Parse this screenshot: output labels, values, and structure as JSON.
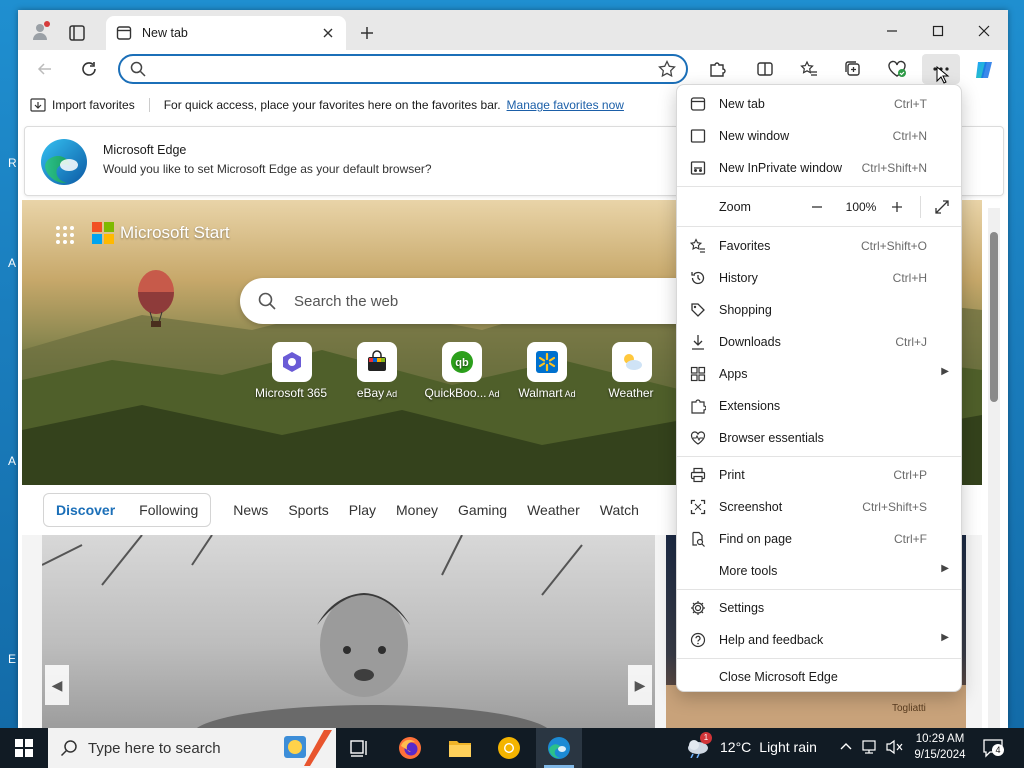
{
  "browser": {
    "tab_title": "New tab",
    "address_value": "",
    "favorites_bar": {
      "import_label": "Import favorites",
      "message": "For quick access, place your favorites here on the favorites bar.",
      "manage_link": "Manage favorites now"
    },
    "banner": {
      "title": "Microsoft Edge",
      "text": "Would you like to set Microsoft Edge as your default browser?"
    }
  },
  "new_tab_page": {
    "brand": "Microsoft Start",
    "search_placeholder": "Search the web",
    "quick_links": [
      {
        "label": "Microsoft 365",
        "ad": ""
      },
      {
        "label": "eBay",
        "ad": "Ad"
      },
      {
        "label": "QuickBoo...",
        "ad": "Ad"
      },
      {
        "label": "Walmart",
        "ad": "Ad"
      },
      {
        "label": "Weather",
        "ad": ""
      }
    ],
    "nav": {
      "discover": "Discover",
      "following": "Following",
      "items": [
        "News",
        "Sports",
        "Play",
        "Money",
        "Gaming",
        "Weather",
        "Watch"
      ]
    },
    "card2_caption": "Togliatti"
  },
  "menu": {
    "new_tab": {
      "label": "New tab",
      "shortcut": "Ctrl+T"
    },
    "new_window": {
      "label": "New window",
      "shortcut": "Ctrl+N"
    },
    "new_inprivate": {
      "label": "New InPrivate window",
      "shortcut": "Ctrl+Shift+N"
    },
    "zoom": {
      "label": "Zoom",
      "value": "100%",
      "minus": "—",
      "plus": "+"
    },
    "favorites": {
      "label": "Favorites",
      "shortcut": "Ctrl+Shift+O"
    },
    "history": {
      "label": "History",
      "shortcut": "Ctrl+H"
    },
    "shopping": {
      "label": "Shopping",
      "shortcut": ""
    },
    "downloads": {
      "label": "Downloads",
      "shortcut": "Ctrl+J"
    },
    "apps": {
      "label": "Apps",
      "shortcut": ""
    },
    "extensions": {
      "label": "Extensions",
      "shortcut": ""
    },
    "browser_essentials": {
      "label": "Browser essentials",
      "shortcut": ""
    },
    "print": {
      "label": "Print",
      "shortcut": "Ctrl+P"
    },
    "screenshot": {
      "label": "Screenshot",
      "shortcut": "Ctrl+Shift+S"
    },
    "find_on_page": {
      "label": "Find on page",
      "shortcut": "Ctrl+F"
    },
    "more_tools": {
      "label": "More tools",
      "shortcut": ""
    },
    "settings": {
      "label": "Settings",
      "shortcut": ""
    },
    "help": {
      "label": "Help and feedback",
      "shortcut": ""
    },
    "close_edge": {
      "label": "Close Microsoft Edge",
      "shortcut": ""
    }
  },
  "taskbar": {
    "search_placeholder": "Type here to search",
    "weather": {
      "temp": "12°C",
      "condition": "Light rain",
      "badge": "1"
    },
    "time": "10:29 AM",
    "date": "9/15/2024",
    "notification_count": "4"
  },
  "colors": {
    "accent": "#1b6fb8",
    "desktop": "#1e86c8",
    "taskbar": "#111b24"
  }
}
